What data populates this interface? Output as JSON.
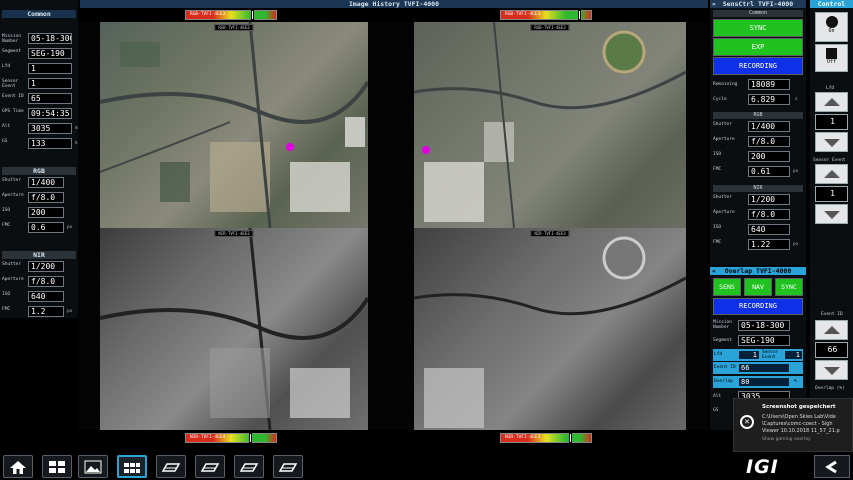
{
  "left_panel": {
    "title": "Common",
    "fields": [
      {
        "label": "Mission Number",
        "value": "05-18-300"
      },
      {
        "label": "Segment",
        "value": "SEG-190"
      },
      {
        "label": "Lfd",
        "value": "1"
      },
      {
        "label": "Sensor Event",
        "value": "1"
      },
      {
        "label": "Event ID",
        "value": "65"
      },
      {
        "label": "GPS Time",
        "value": "09:54:35.7"
      },
      {
        "label": "Alt",
        "value": "3035",
        "unit": "m"
      },
      {
        "label": "GS",
        "value": "133",
        "unit": "kt"
      }
    ],
    "rgb": {
      "title": "RGB",
      "shutter": "1/400",
      "aperture": "f/8.0",
      "iso": "200",
      "fmc": "0.6",
      "fmc_unit": "px"
    },
    "nir": {
      "title": "NIR",
      "shutter": "1/200",
      "aperture": "f/8.0",
      "iso": "640",
      "fmc": "1.2",
      "fmc_unit": "px"
    },
    "labels": {
      "shutter": "Shutter",
      "aperture": "Aperture",
      "iso": "ISO",
      "fmc": "FMC"
    }
  },
  "center": {
    "title": "Image History TVFI-4000",
    "image_tags": [
      "RGB-TVFI-4EE3",
      "RGB-TVFI-4EE3",
      "NIR-TVFI-4EE3",
      "NIR-TVFI-4EE3"
    ],
    "hist_labels": [
      "RGB-TVFI-4EE3",
      "RGB-TVFI-4EE3",
      "NIR-TVFI-4EE4",
      "NIR-TVFI-4EE3"
    ],
    "hist_levels": [
      0.72,
      0.86,
      0.7,
      0.76
    ],
    "colors": {
      "hist_red": "#d82c1c",
      "hist_yellow": "#e8e020",
      "hist_green": "#30b830"
    }
  },
  "sens_ctrl": {
    "title": "SensCtrl TVFI-4000",
    "section": "Common",
    "sync_label": "SYNC",
    "exp_label": "EXP",
    "recording_label": "RECORDING",
    "remaining_label": "Remaining",
    "remaining": "18089",
    "cycle_label": "Cycle",
    "cycle": "6.829",
    "cycle_unit": "s",
    "rgb": {
      "title": "RGB",
      "shutter": "1/400",
      "aperture": "f/8.0",
      "iso": "200",
      "fmc": "0.61",
      "fmc_unit": "px"
    },
    "nir": {
      "title": "NIR",
      "shutter": "1/200",
      "aperture": "f/8.0",
      "iso": "640",
      "fmc": "1.22",
      "fmc_unit": "px"
    },
    "labels": {
      "shutter": "Shutter",
      "aperture": "Aperture",
      "iso": "ISO",
      "fmc": "FMC"
    },
    "colors": {
      "green": "#1fc21f",
      "blue": "#1030e8"
    }
  },
  "overlap": {
    "title": "Overlap TVFI-4000",
    "sens_label": "SENS",
    "nav_label": "NAV",
    "sync_label": "SYNC",
    "recording_label": "RECORDING",
    "mission_label": "Mission Number",
    "mission": "05-18-300",
    "segment_label": "Segment",
    "segment": "SEG-190",
    "lfd_label": "Lfd",
    "lfd": "1",
    "sensor_event_label": "Sensor Event",
    "sensor_event": "1",
    "event_id_label": "Event ID",
    "event_id": "66",
    "overlap_label": "Overlap",
    "overlap_value": "80",
    "overlap_unit": "%",
    "alt_label": "Alt",
    "alt": "3035",
    "gs_label": "GS"
  },
  "control": {
    "title": "Control",
    "on_label": "On",
    "off_label": "Off",
    "lfd_label": "Lfd",
    "lfd_value": "1",
    "sensor_event_label": "Sensor Event",
    "sensor_event_value": "1",
    "event_id_label": "Event ID",
    "event_id_value": "66",
    "overlap_label": "Overlap (%)"
  },
  "toast": {
    "title": "Screenshot gespeichert",
    "line1": "C:\\Users\\Open Skies Lab\\Vide",
    "line2": "\\Captures\\comc-coect - Sigh",
    "line3": "Viewer 10.10.2018 11_57_21.p",
    "line4": "Show gaming overlay"
  },
  "brand": "IGI",
  "taskbar_icons": [
    "home-icon",
    "grid-icon",
    "image-icon",
    "mosaic-icon",
    "camera-icon",
    "camera-icon",
    "camera-icon",
    "camera-icon"
  ]
}
